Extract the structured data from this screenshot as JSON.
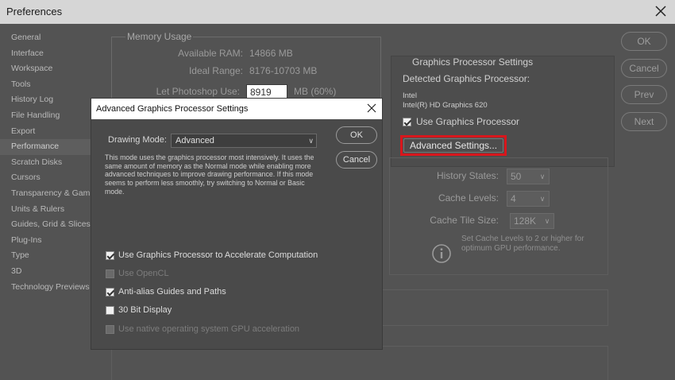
{
  "window": {
    "title": "Preferences"
  },
  "sidebar": {
    "items": [
      {
        "label": "General"
      },
      {
        "label": "Interface"
      },
      {
        "label": "Workspace"
      },
      {
        "label": "Tools"
      },
      {
        "label": "History Log"
      },
      {
        "label": "File Handling"
      },
      {
        "label": "Export"
      },
      {
        "label": "Performance",
        "active": true
      },
      {
        "label": "Scratch Disks"
      },
      {
        "label": "Cursors"
      },
      {
        "label": "Transparency & Gamut"
      },
      {
        "label": "Units & Rulers"
      },
      {
        "label": "Guides, Grid & Slices"
      },
      {
        "label": "Plug-Ins"
      },
      {
        "label": "Type"
      },
      {
        "label": "3D"
      },
      {
        "label": "Technology Previews"
      }
    ]
  },
  "memory": {
    "title": "Memory Usage",
    "available_label": "Available RAM:",
    "available_value": "14866 MB",
    "ideal_label": "Ideal Range:",
    "ideal_value": "8176-10703 MB",
    "let_label": "Let Photoshop Use:",
    "let_value": "8919",
    "let_unit": "MB (60%)"
  },
  "history": {
    "states_label": "History States:",
    "states_value": "50",
    "levels_label": "Cache Levels:",
    "levels_value": "4",
    "tile_label": "Cache Tile Size:",
    "tile_value": "128K",
    "hint": "Set Cache Levels to 2 or higher for optimum GPU performance."
  },
  "gpu": {
    "title": "Graphics Processor Settings",
    "detected_label": "Detected Graphics Processor:",
    "vendor": "Intel",
    "model": "Intel(R) HD Graphics 620",
    "use_gpu_label": "Use Graphics Processor",
    "use_gpu_checked": true,
    "advanced_button": "Advanced Settings..."
  },
  "buttons": {
    "ok": "OK",
    "cancel": "Cancel",
    "prev": "Prev",
    "next": "Next"
  },
  "dialog": {
    "title": "Advanced Graphics Processor Settings",
    "mode_label": "Drawing Mode:",
    "mode_value": "Advanced",
    "description": "This mode uses the graphics processor most intensively.  It uses the same amount of memory as the Normal mode while enabling more advanced techniques to improve drawing performance.  If this mode seems to perform less smoothly, try switching to Normal or Basic mode.",
    "ok": "OK",
    "cancel": "Cancel",
    "options": [
      {
        "label": "Use Graphics Processor to Accelerate Computation",
        "checked": true,
        "disabled": false
      },
      {
        "label": "Use OpenCL",
        "checked": false,
        "disabled": true
      },
      {
        "label": "Anti-alias Guides and Paths",
        "checked": true,
        "disabled": false
      },
      {
        "label": "30 Bit Display",
        "checked": false,
        "disabled": false
      },
      {
        "label": "Use native operating system GPU acceleration",
        "checked": false,
        "disabled": true
      }
    ]
  },
  "colors": {
    "accent_highlight": "#d8161c",
    "background": "#535353",
    "dialog_background": "#4a4a4a"
  }
}
